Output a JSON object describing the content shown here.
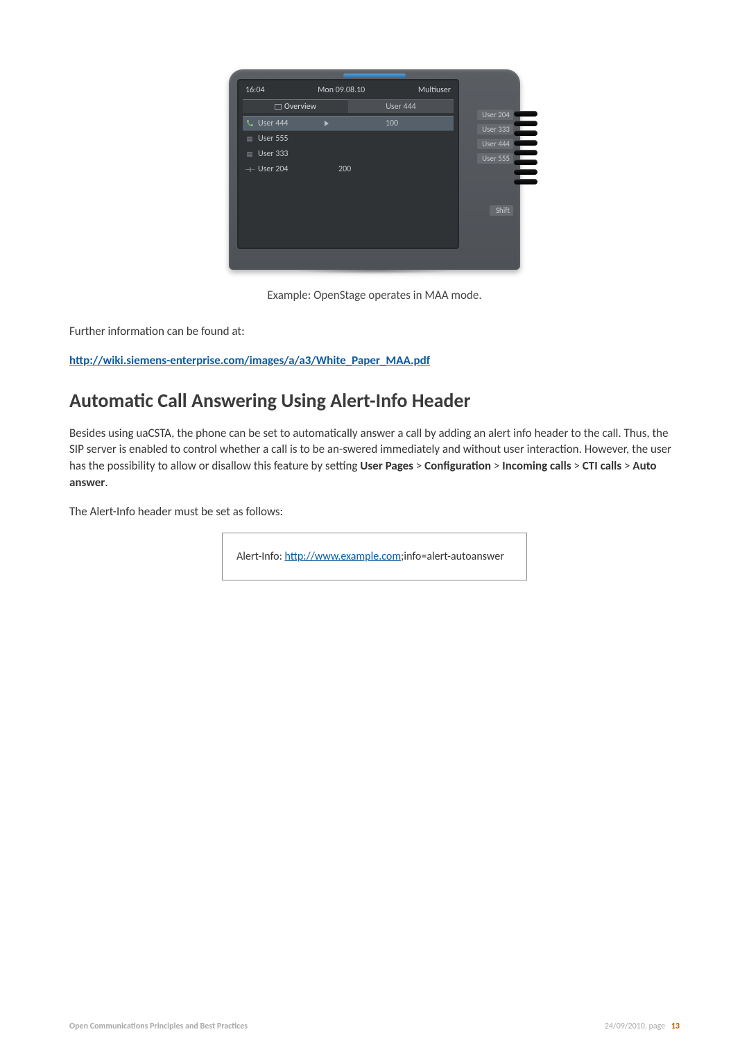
{
  "phone": {
    "status": {
      "time": "16:04",
      "date": "Mon 09.08.10",
      "mode": "Multiuser"
    },
    "tabs": [
      {
        "label": "Overview",
        "active": true
      },
      {
        "label": "User 444",
        "active": false
      }
    ],
    "rows": [
      {
        "icon": "handset",
        "name": "User 444",
        "num": "100",
        "selected": true,
        "arrow": true
      },
      {
        "icon": "list",
        "name": "User 555",
        "num": "",
        "selected": false
      },
      {
        "icon": "list",
        "name": "User 333",
        "num": "",
        "selected": false
      },
      {
        "icon": "pause",
        "name": "User 204",
        "num": "200",
        "selected": false
      }
    ],
    "side_labels": [
      "User 204",
      "User 333",
      "User 444",
      "User 555"
    ],
    "shift_label": "Shift"
  },
  "caption": "Example: OpenStage operates in MAA mode.",
  "further_info": "Further information can be found at:",
  "link_url": "http://wiki.siemens-enterprise.com/images/a/a3/White_Paper_MAA.pdf",
  "section_heading": "Automatic Call Answering Using Alert-Info Header",
  "para1_a": "Besides using uaCSTA, the phone can be set to automatically answer a call by adding an alert info header to the call. Thus, the SIP server is enabled to control whether a call is to be an-swered immediately and without user interaction. However, the user has the possibility to allow or disallow this feature by setting ",
  "crumbs": {
    "user_pages": "User Pages",
    "configuration": "Configuration",
    "incoming_calls": "Incoming calls",
    "cti_calls": "CTI calls",
    "auto_answer": "Auto answer"
  },
  "sep": " > ",
  "para2": "The Alert-Info header must be set as follows:",
  "box_prefix": "Alert-Info: ",
  "box_link": "http://www.example.com",
  "box_suffix": ";info=alert-autoanswer",
  "footer": {
    "left": "Open Communications Principles and Best Practices",
    "right_date": "24/09/2010, page",
    "page_num": "13"
  }
}
